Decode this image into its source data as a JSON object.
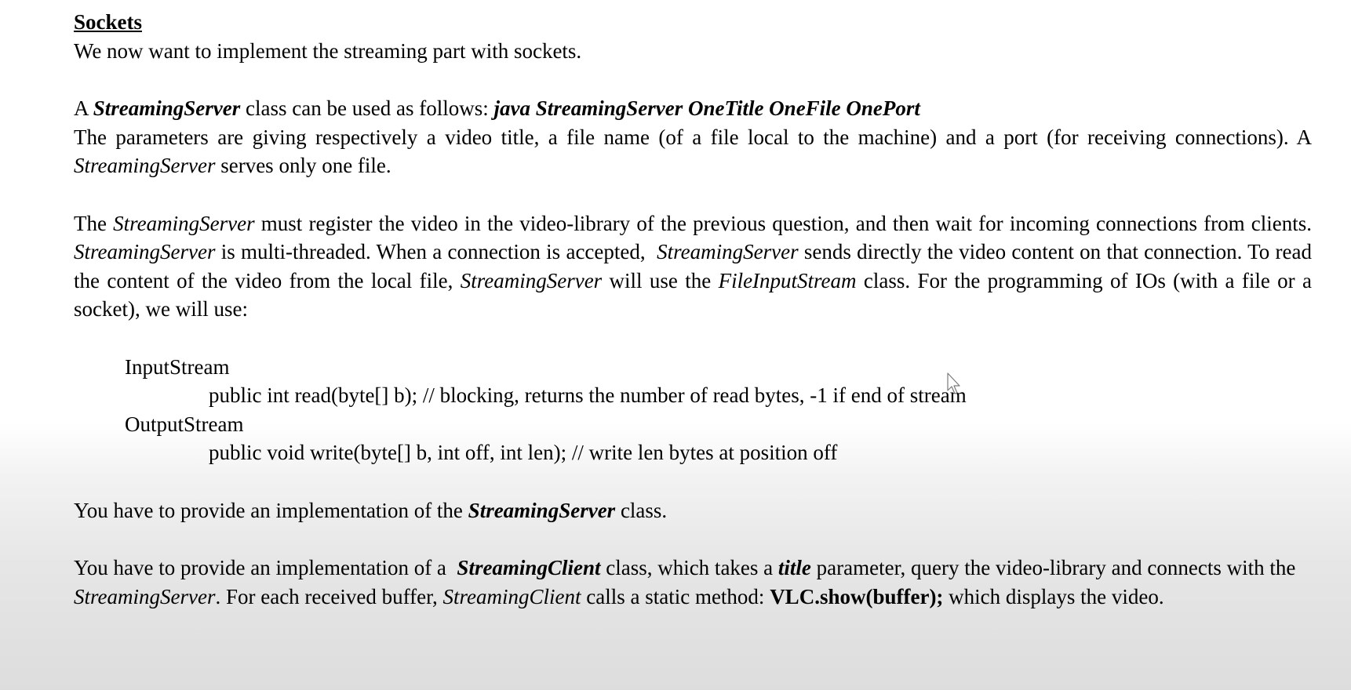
{
  "doc": {
    "heading": "Sockets",
    "intro": "We now want to implement the streaming part with sockets.",
    "p1": {
      "prefix": "A ",
      "class_name": "StreamingServer",
      "mid": " class can be used as follows: ",
      "command": "java StreamingServer OneTitle OneFile OnePort"
    },
    "p2": {
      "text1": "The parameters are giving respectively a video title, a file name (of a file local to the machine) and a port (for receiving connections). A ",
      "class_name": "StreamingServer",
      "text2": " serves only one file."
    },
    "p3": {
      "t1": "The ",
      "c1": "StreamingServer",
      "t2": " must register the video in the video-library of the previous question, and then wait for incoming connections from clients. ",
      "c2": "StreamingServer",
      "t3": " is multi-threaded. When a connection is accepted,  ",
      "c3": "StreamingServer",
      "t4": " sends directly the video content on that connection. To read the content of the video from the local file, ",
      "c4": "StreamingServer",
      "t5": " will use the ",
      "c5": "FileInputStream",
      "t6": " class. For the programming of IOs (with a file or a socket), we will use:"
    },
    "api": {
      "input_type": "InputStream",
      "input_method": "public int read(byte[] b); // blocking, returns the number of read bytes, -1 if end of stream",
      "output_type": "OutputStream",
      "output_method": "public void write(byte[] b, int off, int len); // write len bytes at position off"
    },
    "p4": {
      "t1": "You have to provide an implementation of the ",
      "class_name": "StreamingServer",
      "t2": " class."
    },
    "p5": {
      "t1": "You have to provide an implementation of a  ",
      "c1": "StreamingClient",
      "t2": " class, which takes a ",
      "param": "title",
      "t3": " parameter, query the video-library and connects with the ",
      "c2": "StreamingServer",
      "t4": ". For each received buffer, ",
      "c3": "StreamingClient",
      "t5": " calls a static method: ",
      "call": "VLC.show(buffer);",
      "t6": " which displays the video."
    }
  },
  "icons": {
    "cursor": "mouse-pointer-icon"
  }
}
